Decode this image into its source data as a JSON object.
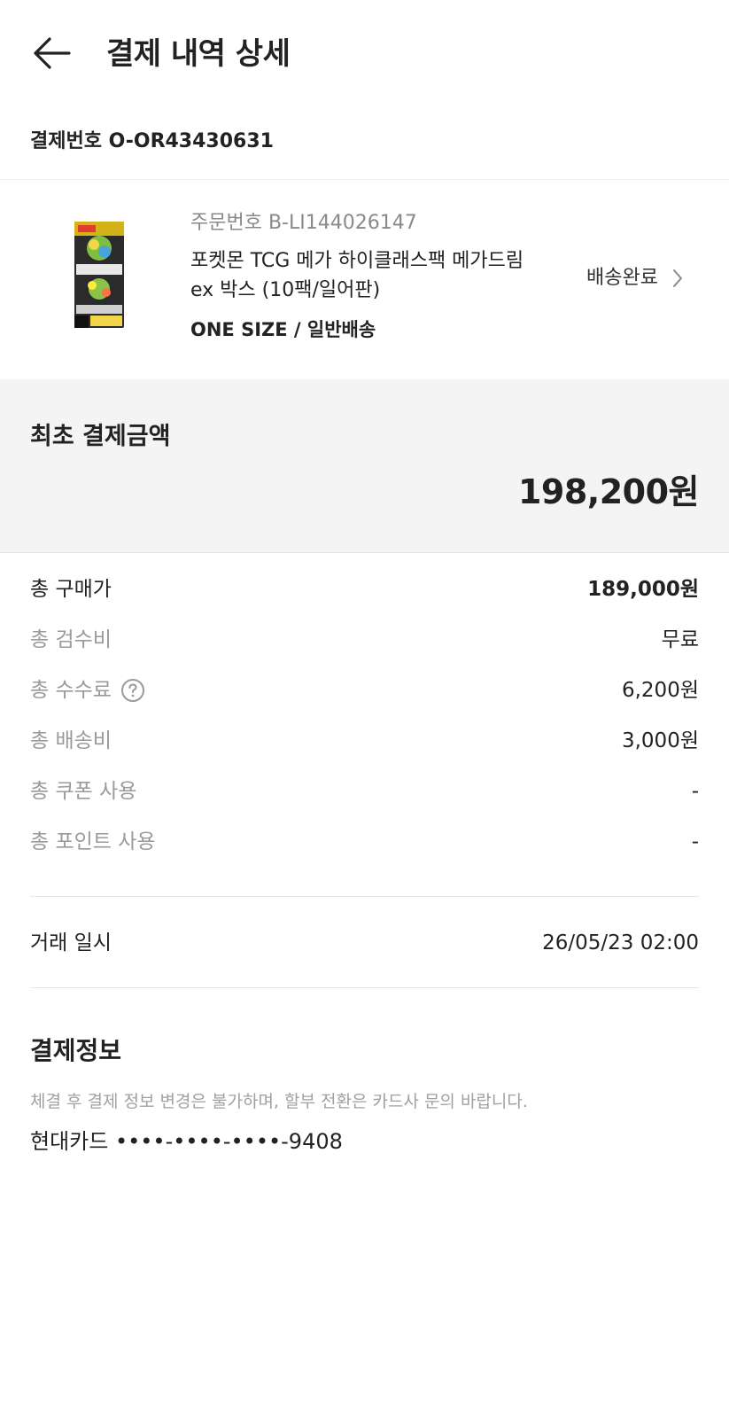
{
  "header": {
    "title": "결제 내역 상세"
  },
  "payment": {
    "number": "결제번호 O-OR43430631"
  },
  "order": {
    "number": "주문번호 B-LI144026147",
    "product_name": "포켓몬 TCG 메가 하이클래스팩 메가드림 ex 박스 (10팩/일어판)",
    "option": "ONE SIZE / 일반배송",
    "status": "배송완료"
  },
  "total": {
    "label": "최초 결제금액",
    "amount": "198,200원"
  },
  "breakdown": [
    {
      "label": "총 구매가",
      "value": "189,000원"
    },
    {
      "label": "총 검수비",
      "value": "무료"
    },
    {
      "label": "총 수수료",
      "value": "6,200원"
    },
    {
      "label": "총 배송비",
      "value": "3,000원"
    },
    {
      "label": "총 쿠폰 사용",
      "value": "-"
    },
    {
      "label": "총 포인트 사용",
      "value": "-"
    }
  ],
  "transaction": {
    "label": "거래 일시",
    "value": "26/05/23 02:00"
  },
  "payment_info": {
    "title": "결제정보",
    "notice": "체결 후 결제 정보 변경은 불가하며, 할부 전환은 카드사 문의 바랍니다.",
    "card": "현대카드 ••••-••••-••••-9408"
  },
  "icons": {
    "back": "arrow-left-icon",
    "status_chevron": "chevron-right-icon",
    "help": "question-circle-icon"
  },
  "colors": {
    "text_primary": "#222222",
    "text_secondary": "#9a9a9a",
    "summary_bg": "#f4f4f4"
  }
}
